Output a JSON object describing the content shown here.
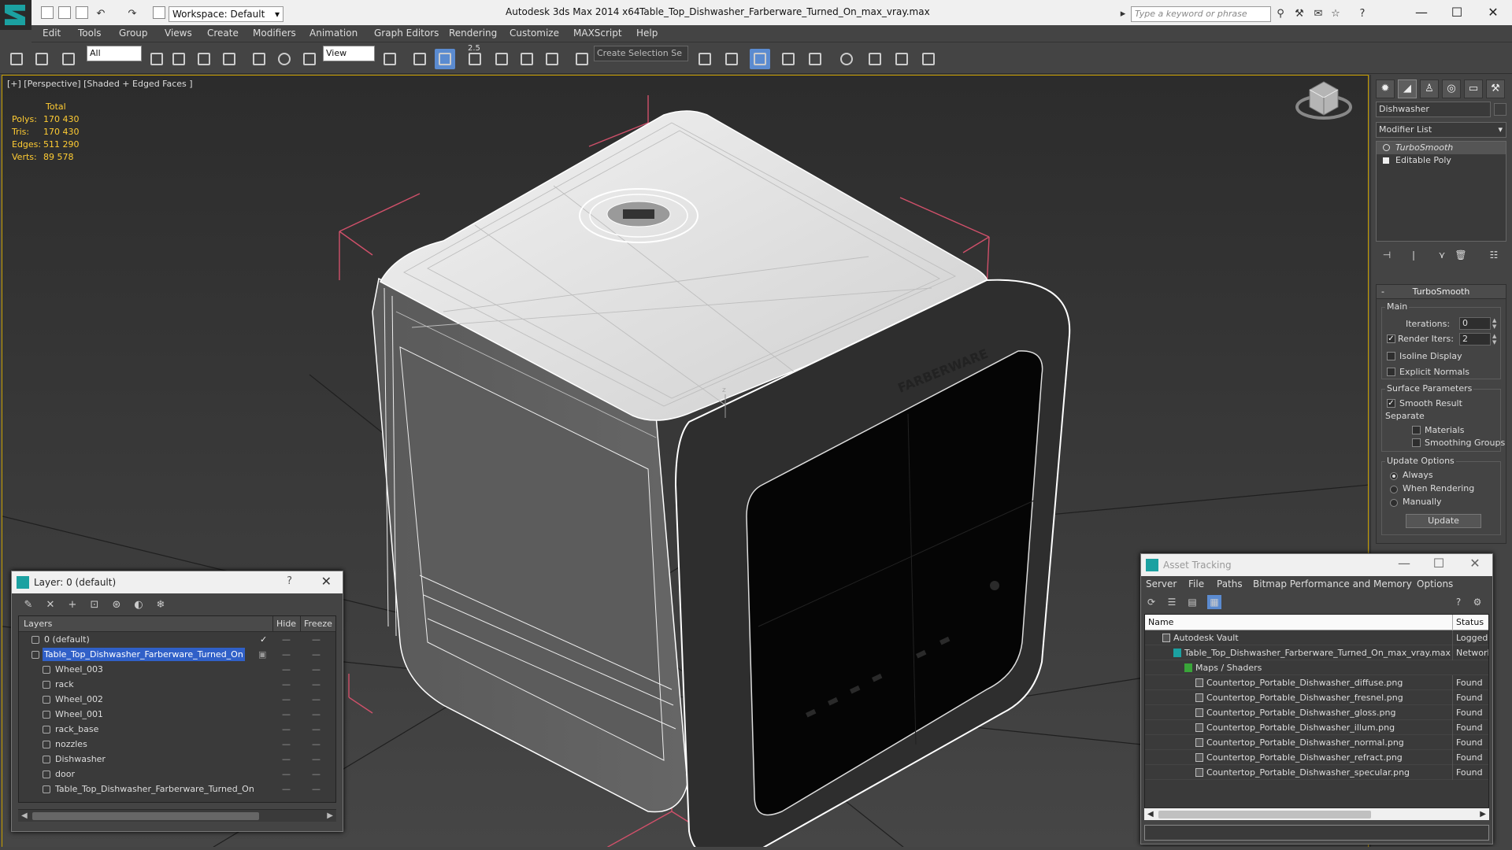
{
  "titlebar": {
    "app": "Autodesk 3ds Max  2014 x64",
    "document": "Table_Top_Dishwasher_Farberware_Turned_On_max_vray.max",
    "workspace": "Workspace: Default",
    "search_placeholder": "Type a keyword or phrase"
  },
  "menu": [
    "Edit",
    "Tools",
    "Group",
    "Views",
    "Create",
    "Modifiers",
    "Animation",
    "Graph Editors",
    "Rendering",
    "Customize",
    "MAXScript",
    "Help"
  ],
  "toolbar": {
    "filter": "All",
    "ref_coord": "View",
    "snap_angle": "2.5",
    "selection_set": "Create Selection Se"
  },
  "viewport": {
    "label": "[+] [Perspective] [Shaded + Edged Faces ]",
    "stats_header": "Total",
    "stats": [
      {
        "k": "Polys:",
        "v": "170 430"
      },
      {
        "k": "Tris:",
        "v": "170 430"
      },
      {
        "k": "Edges:",
        "v": "511 290"
      },
      {
        "k": "Verts:",
        "v": "89 578"
      }
    ]
  },
  "command_panel": {
    "object_name": "Dishwasher",
    "modifier_list": "Modifier List",
    "stack": [
      {
        "label": "TurboSmooth",
        "selected": true
      },
      {
        "label": "Editable Poly",
        "selected": false
      }
    ],
    "rollout_title": "TurboSmooth",
    "main_group": "Main",
    "iterations_label": "Iterations:",
    "iterations": "0",
    "render_iters_label": "Render Iters:",
    "render_iters": "2",
    "isoline": "Isoline Display",
    "explicit_normals": "Explicit Normals",
    "surface_group": "Surface Parameters",
    "smooth_result": "Smooth Result",
    "separate": "Separate",
    "materials": "Materials",
    "smoothing_groups": "Smoothing Groups",
    "update_group": "Update Options",
    "always": "Always",
    "when_rendering": "When Rendering",
    "manually": "Manually",
    "update_button": "Update"
  },
  "layer_dialog": {
    "title": "Layer: 0 (default)",
    "col_layers": "Layers",
    "col_hide": "Hide",
    "col_freeze": "Freeze",
    "rows": [
      {
        "name": "0 (default)",
        "indent": 0,
        "selected": false,
        "check": true
      },
      {
        "name": "Table_Top_Dishwasher_Farberware_Turned_On",
        "indent": 0,
        "selected": true,
        "check": false
      },
      {
        "name": "Wheel_003",
        "indent": 1,
        "selected": false,
        "check": false
      },
      {
        "name": "rack",
        "indent": 1,
        "selected": false,
        "check": false
      },
      {
        "name": "Wheel_002",
        "indent": 1,
        "selected": false,
        "check": false
      },
      {
        "name": "Wheel_001",
        "indent": 1,
        "selected": false,
        "check": false
      },
      {
        "name": "rack_base",
        "indent": 1,
        "selected": false,
        "check": false
      },
      {
        "name": "nozzles",
        "indent": 1,
        "selected": false,
        "check": false
      },
      {
        "name": "Dishwasher",
        "indent": 1,
        "selected": false,
        "check": false
      },
      {
        "name": "door",
        "indent": 1,
        "selected": false,
        "check": false
      },
      {
        "name": "Table_Top_Dishwasher_Farberware_Turned_On",
        "indent": 1,
        "selected": false,
        "check": false
      }
    ]
  },
  "asset_dialog": {
    "title": "Asset Tracking",
    "menu": [
      "Server",
      "File",
      "Paths",
      "Bitmap Performance and Memory",
      "Options"
    ],
    "col_name": "Name",
    "col_status": "Status",
    "rows": [
      {
        "name": "Autodesk Vault",
        "indent": 0,
        "status": "Logged C",
        "icon": "vault"
      },
      {
        "name": "Table_Top_Dishwasher_Farberware_Turned_On_max_vray.max",
        "indent": 1,
        "status": "Network",
        "icon": "max"
      },
      {
        "name": "Maps / Shaders",
        "indent": 2,
        "status": "",
        "icon": "maps"
      },
      {
        "name": "Countertop_Portable_Dishwasher_diffuse.png",
        "indent": 3,
        "status": "Found",
        "icon": "file"
      },
      {
        "name": "Countertop_Portable_Dishwasher_fresnel.png",
        "indent": 3,
        "status": "Found",
        "icon": "file"
      },
      {
        "name": "Countertop_Portable_Dishwasher_gloss.png",
        "indent": 3,
        "status": "Found",
        "icon": "file"
      },
      {
        "name": "Countertop_Portable_Dishwasher_illum.png",
        "indent": 3,
        "status": "Found",
        "icon": "file"
      },
      {
        "name": "Countertop_Portable_Dishwasher_normal.png",
        "indent": 3,
        "status": "Found",
        "icon": "file"
      },
      {
        "name": "Countertop_Portable_Dishwasher_refract.png",
        "indent": 3,
        "status": "Found",
        "icon": "file"
      },
      {
        "name": "Countertop_Portable_Dishwasher_specular.png",
        "indent": 3,
        "status": "Found",
        "icon": "file"
      }
    ]
  },
  "colors": {
    "accent": "#5b8bd0",
    "selection": "#3060c8",
    "stats": "#ffcc33",
    "viewport_border": "#c9a000",
    "bbox": "#d0506a"
  }
}
